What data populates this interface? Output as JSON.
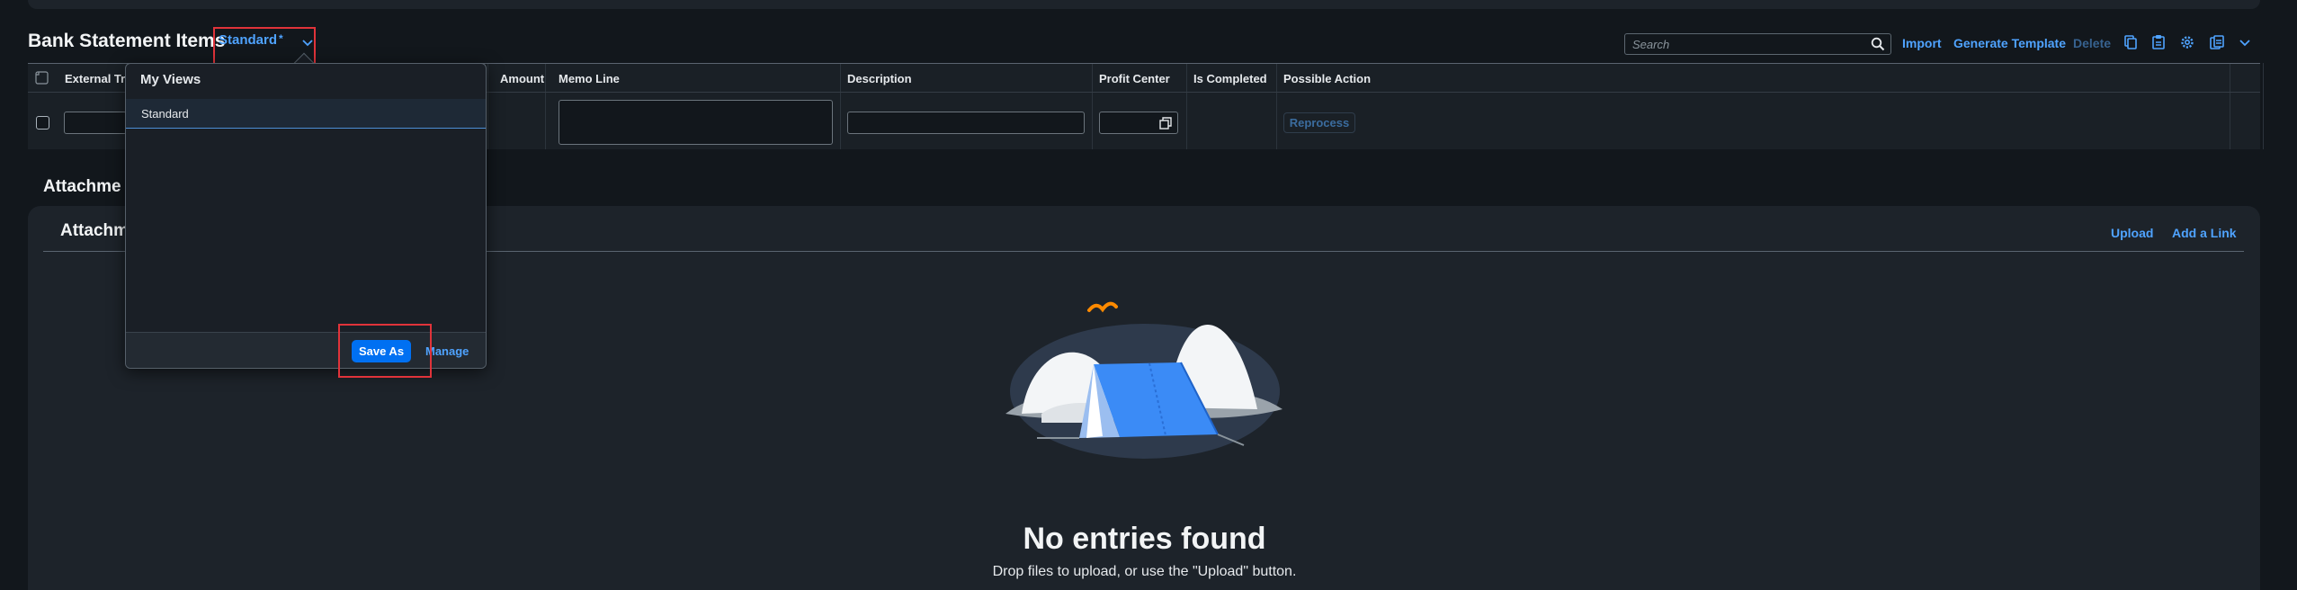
{
  "bank_statement": {
    "title": "Bank Statement Items",
    "variant": {
      "name": "Standard",
      "modified_marker": "*"
    },
    "search": {
      "placeholder": "Search",
      "value": ""
    },
    "toolbar": {
      "import_label": "Import",
      "generate_template_label": "Generate Template",
      "delete_label": "Delete",
      "icons": [
        "copy-icon",
        "paste-icon",
        "settings-icon",
        "export-icon",
        "chevron-down-icon"
      ]
    },
    "columns": [
      "External Tr",
      "Amount",
      "Memo Line",
      "Description",
      "Profit Center",
      "Is Completed",
      "Possible Action"
    ],
    "row": {
      "action_label": "Reprocess"
    }
  },
  "views_popover": {
    "title": "My Views",
    "items": [
      "Standard"
    ],
    "save_as_label": "Save As",
    "manage_label": "Manage"
  },
  "attachments": {
    "section_title": "Attachme",
    "panel_title": "Attachm",
    "upload_label": "Upload",
    "add_link_label": "Add a Link",
    "empty_title": "No entries found",
    "empty_subtitle": "Drop files to upload, or use the \"Upload\" button."
  },
  "colors": {
    "background": "#12171c",
    "panel": "#1d232a",
    "accent": "#4fa3ff",
    "primary_button": "#0070f2",
    "highlight_box": "#e0333a"
  }
}
